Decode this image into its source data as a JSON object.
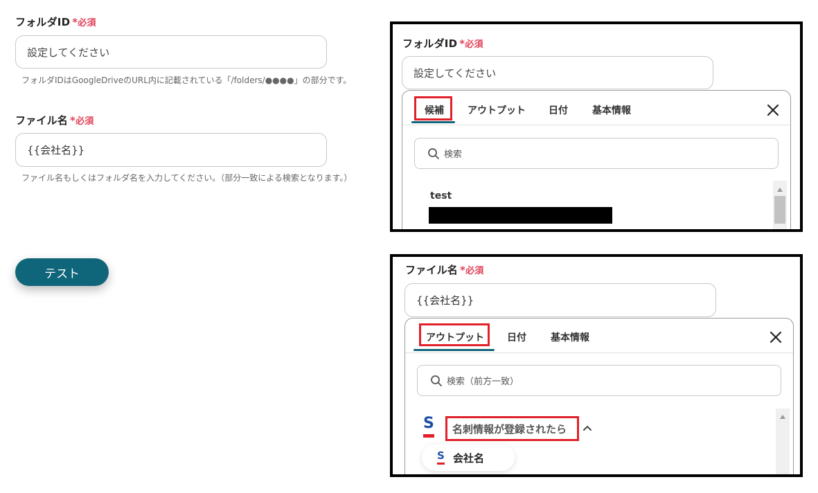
{
  "left_form": {
    "folder_field": {
      "label": "フォルダID",
      "required_mark": "*",
      "required_text": "必須",
      "placeholder": "設定してください",
      "hint": "フォルダIDはGoogleDriveのURL内に記載されている「/folders/●●●●」の部分です。"
    },
    "file_field": {
      "label": "ファイル名",
      "required_mark": "*",
      "required_text": "必須",
      "value": "{{会社名}}",
      "hint": "ファイル名もしくはフォルダ名を入力してください。（部分一致による検索となります。）"
    },
    "test_button": "テスト"
  },
  "panel1": {
    "label": "フォルダID",
    "required_mark": "*",
    "required_text": "必須",
    "placeholder": "設定してください",
    "tabs": [
      "候補",
      "アウトプット",
      "日付",
      "基本情報"
    ],
    "active_tab": "候補",
    "search_placeholder": "検索",
    "list": [
      {
        "label": "test",
        "value_redacted": true
      }
    ]
  },
  "panel2": {
    "label": "ファイル名",
    "required_mark": "*",
    "required_text": "必須",
    "value": "{{会社名}}",
    "tabs": [
      "アウトプット",
      "日付",
      "基本情報"
    ],
    "active_tab": "アウトプット",
    "search_placeholder": "検索（前方一致）",
    "group_label": "名刺情報が登録されたら",
    "group_icon": "chevron-up-icon",
    "item_label": "会社名",
    "app_logo_letter": "S"
  },
  "colors": {
    "accent": "#0f6579",
    "required": "#e0435a",
    "highlight": "#e0212a",
    "logo_blue": "#1e4fa3"
  }
}
